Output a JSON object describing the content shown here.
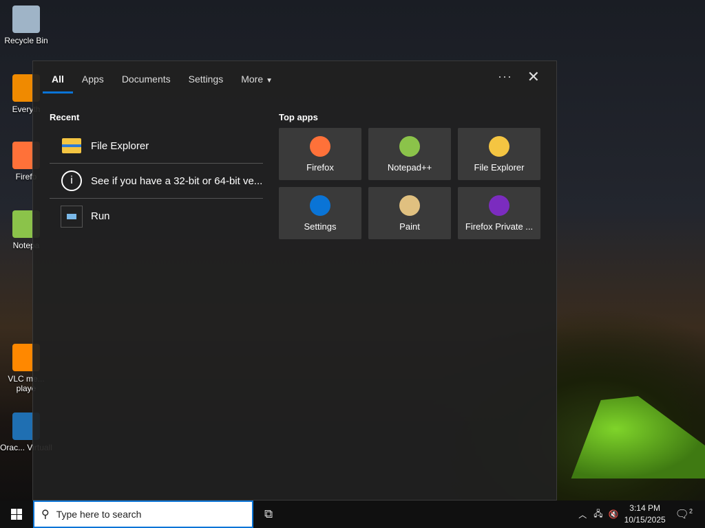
{
  "desktop": {
    "icons": [
      {
        "label": "Recycle Bin",
        "color": "#9fb4c7"
      },
      {
        "label": "Everyth",
        "color": "#f08a00"
      },
      {
        "label": "Firefo",
        "color": "#ff7139"
      },
      {
        "label": "Notepa",
        "color": "#8bc34a"
      },
      {
        "label": "VLC me... playe",
        "color": "#ff8800"
      },
      {
        "label": "Orac... Virtuall",
        "color": "#1f6fb2"
      }
    ]
  },
  "search_panel": {
    "tabs": [
      {
        "label": "All",
        "active": true
      },
      {
        "label": "Apps"
      },
      {
        "label": "Documents"
      },
      {
        "label": "Settings"
      },
      {
        "label": "More"
      }
    ],
    "more_icon": "caret-down-icon",
    "options_icon": "···",
    "close_icon": "✕",
    "recent_heading": "Recent",
    "recent": [
      {
        "label": "File Explorer",
        "icon": "folder-icon"
      },
      {
        "label": "See if you have a 32-bit or 64-bit ve...",
        "icon": "info-icon"
      },
      {
        "label": "Run",
        "icon": "run-icon"
      }
    ],
    "top_apps_heading": "Top apps",
    "top_apps": [
      {
        "label": "Firefox",
        "color": "#ff7139"
      },
      {
        "label": "Notepad++",
        "color": "#8bc34a"
      },
      {
        "label": "File Explorer",
        "color": "#f4c542"
      },
      {
        "label": "Settings",
        "color": "#0a74d6"
      },
      {
        "label": "Paint",
        "color": "#e0c080"
      },
      {
        "label": "Firefox Private ...",
        "color": "#7b2cbf"
      }
    ]
  },
  "taskbar": {
    "search_placeholder": "Type here to search",
    "time": "3:14 PM",
    "date": "10/15/2025",
    "notifications": "2",
    "accent": "#0a74d6"
  }
}
